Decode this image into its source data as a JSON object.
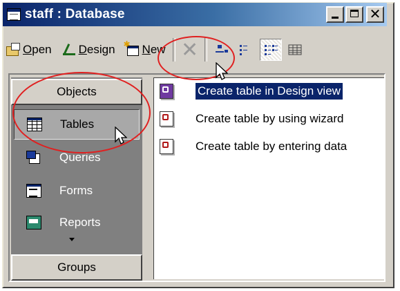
{
  "window": {
    "title": "staff : Database",
    "controls": {
      "minimize": "minimize",
      "maximize": "maximize",
      "close": "✕"
    }
  },
  "toolbar": {
    "open_prefix": "O",
    "open_rest": "pen",
    "design_prefix": "D",
    "design_rest": "esign",
    "new_prefix": "N",
    "new_rest": "ew",
    "delete_icon": "✕",
    "large_icons_icon": "large-icons",
    "small_icons_icon": "small-icons",
    "list_icon": "list-view",
    "details_icon": "details-view"
  },
  "sidebar": {
    "objects_header": "Objects",
    "groups_header": "Groups",
    "items": [
      {
        "label": "Tables",
        "icon": "table-icon",
        "selected": true
      },
      {
        "label": "Queries",
        "icon": "query-icon",
        "selected": false
      },
      {
        "label": "Forms",
        "icon": "form-icon",
        "selected": false
      },
      {
        "label": "Reports",
        "icon": "report-icon",
        "selected": false
      }
    ]
  },
  "list": {
    "items": [
      {
        "label": "Create table in Design view",
        "selected": true
      },
      {
        "label": "Create table by using wizard",
        "selected": false
      },
      {
        "label": "Create table by entering data",
        "selected": false
      }
    ]
  },
  "colors": {
    "title_gradient_start": "#0a246a",
    "title_gradient_end": "#a6caf0",
    "annotation": "#e02020",
    "selection": "#0a246a"
  }
}
